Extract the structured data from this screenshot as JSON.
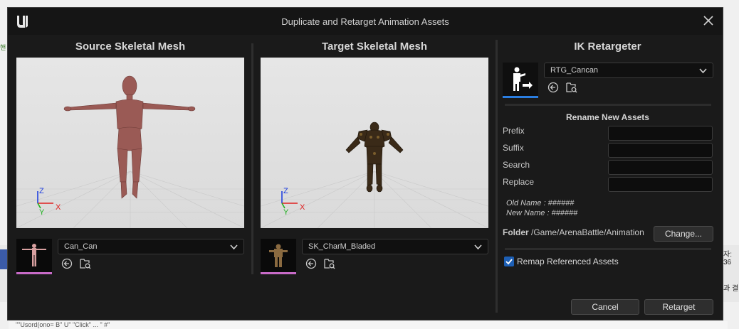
{
  "dialog": {
    "title": "Duplicate and Retarget Animation Assets",
    "logo": "unreal-logo-icon",
    "close_icon": "close-icon"
  },
  "source": {
    "heading": "Source Skeletal Mesh",
    "mesh_name": "Can_Can",
    "axes": {
      "z": "Z",
      "y": "Y",
      "x": "X"
    }
  },
  "target": {
    "heading": "Target Skeletal Mesh",
    "mesh_name": "SK_CharM_Bladed",
    "axes": {
      "z": "Z",
      "y": "Y",
      "x": "X"
    }
  },
  "retargeter": {
    "heading": "IK Retargeter",
    "asset_name": "RTG_Cancan"
  },
  "rename": {
    "heading": "Rename New Assets",
    "prefix_label": "Prefix",
    "suffix_label": "Suffix",
    "search_label": "Search",
    "replace_label": "Replace",
    "prefix_value": "",
    "suffix_value": "",
    "search_value": "",
    "replace_value": "",
    "old_name": "Old Name : ######",
    "new_name": "New Name : ######"
  },
  "folder": {
    "label": "Folder",
    "path": "/Game/ArenaBattle/Animation",
    "change_button": "Change..."
  },
  "remap": {
    "label": "Remap Referenced Assets",
    "checked": true
  },
  "actions": {
    "cancel": "Cancel",
    "retarget": "Retarget"
  },
  "background": {
    "left_fragment": "핸",
    "right_top": "자: 36",
    "right_mid": "과 결",
    "bottom_text": "\"\"Usord(ono= B\" U\" \"Click\" ... \" #\""
  },
  "colors": {
    "accent": "#1d5fb5",
    "thumb_underline": "#c86bc8",
    "axis_x": "#e02020",
    "axis_y": "#20b020",
    "axis_z": "#2040e0"
  }
}
